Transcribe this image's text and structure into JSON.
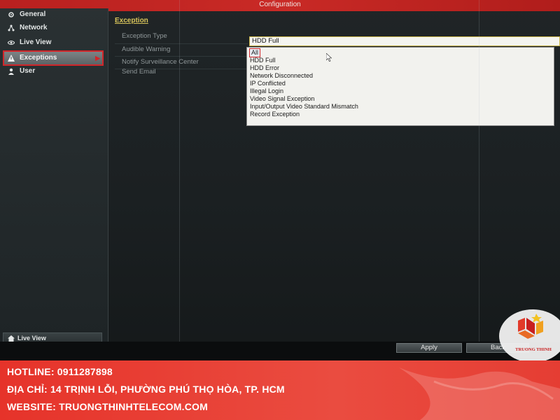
{
  "window": {
    "title": "Configuration"
  },
  "sidebar": {
    "items": [
      {
        "label": "General",
        "icon": "gear-icon"
      },
      {
        "label": "Network",
        "icon": "network-icon"
      },
      {
        "label": "Live View",
        "icon": "live-view-icon"
      },
      {
        "label": "Exceptions",
        "icon": "warning-icon",
        "selected": true
      },
      {
        "label": "User",
        "icon": "user-icon"
      }
    ],
    "live_view_button": "Live View"
  },
  "main": {
    "section_title": "Exception",
    "fields": {
      "exception_type": "Exception Type",
      "audible_warning": "Audible Warning",
      "notify_center": "Notify Surveillance Center",
      "send_email": "Send Email"
    },
    "exception_type_value": "HDD Full",
    "dropdown_options": [
      "All",
      "HDD Full",
      "HDD Error",
      "Network Disconnected",
      "IP Conflicted",
      "Illegal Login",
      "Video Signal Exception",
      "Input/Output Video Standard Mismatch",
      "Record Exception"
    ],
    "apply_label": "Apply",
    "back_label": "Back"
  },
  "watermark": {
    "brand": "TRUONG THINH"
  },
  "footer": {
    "hotline": "HOTLINE: 0911287898",
    "address": "ĐỊA CHỈ: 14 TRỊNH LỖI, PHƯỜNG PHÚ THỌ HÒA, TP. HCM",
    "website": "WEBSITE: TRUONGTHINHTELECOM.COM"
  },
  "colors": {
    "title_bar": "#c92a26",
    "selection_outline": "#d1262a",
    "section_title": "#d8c45a",
    "footer_background": "#e6332a"
  }
}
